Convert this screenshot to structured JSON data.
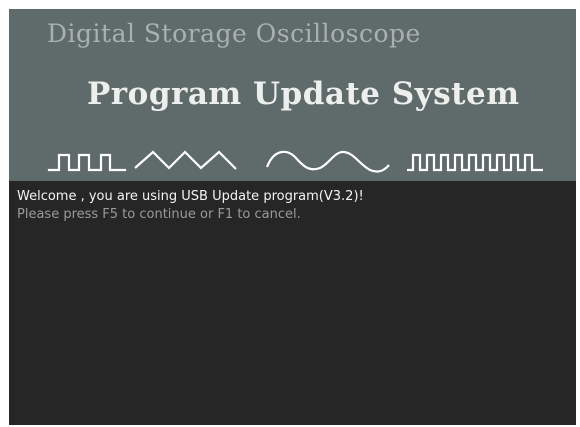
{
  "header": {
    "subtitle": "Digital Storage Oscilloscope",
    "title": "Program Update System",
    "waveform_icons": [
      "square-wave-icon",
      "triangle-wave-icon",
      "sine-wave-icon",
      "pulse-train-icon"
    ]
  },
  "console": {
    "line_1": "Welcome , you are using USB Update program(V3.2)!",
    "line_2": "Please press  F5 to continue or F1  to cancel."
  },
  "colors": {
    "header_background": "#5f6a6b",
    "console_background": "#262626",
    "title_text": "#ecefec",
    "subtitle_text": "#a9b0b1",
    "console_primary_text": "#f4f4f4",
    "console_secondary_text": "#9a9a9a"
  }
}
